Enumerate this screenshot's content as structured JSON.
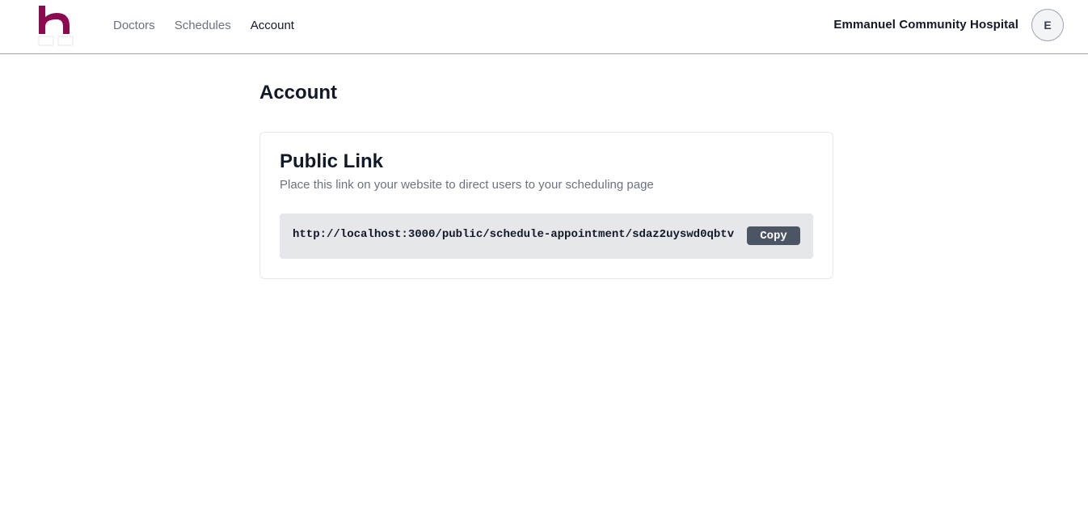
{
  "brand": {
    "logo_icon": "hospital-h-logo",
    "accent_color": "#8a0b4f"
  },
  "nav": {
    "items": [
      {
        "label": "Doctors",
        "active": false
      },
      {
        "label": "Schedules",
        "active": false
      },
      {
        "label": "Account",
        "active": true
      }
    ]
  },
  "header": {
    "organization": "Emmanuel Community Hospital",
    "avatar_initial": "E"
  },
  "main": {
    "page_title": "Account",
    "public_link": {
      "title": "Public Link",
      "description": "Place this link on your website to direct users to your scheduling page",
      "url": "http://localhost:3000/public/schedule-appointment/sdaz2uyswd0qbtv",
      "copy_label": "Copy"
    }
  }
}
